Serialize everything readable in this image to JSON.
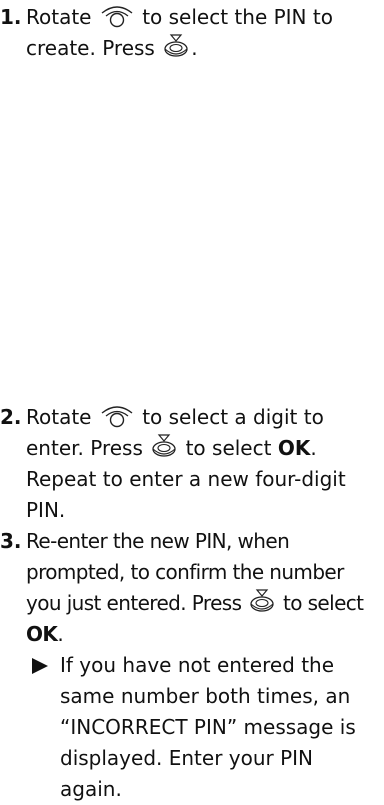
{
  "steps": [
    {
      "number": "1.",
      "text_a": "Rotate",
      "text_b": "to select the PIN to create. Press",
      "text_c": "."
    },
    {
      "number": "2.",
      "text_a": "Rotate",
      "text_b": "to select a digit to enter. Press",
      "text_c": "to select",
      "ok": "OK",
      "text_d": ". Repeat to enter a new four-digit PIN."
    },
    {
      "number": "3.",
      "text_a": "Re-enter the new PIN, when prompted, to confirm the number you just entered. Press",
      "text_b": "to select",
      "ok": "OK",
      "text_c": ".",
      "note": "If you have not entered the same number both times, an “INCORRECT PIN” message is displayed. Enter your PIN again."
    }
  ],
  "icons": {
    "rotate": "rotary-dial-icon",
    "press": "press-knob-icon"
  }
}
